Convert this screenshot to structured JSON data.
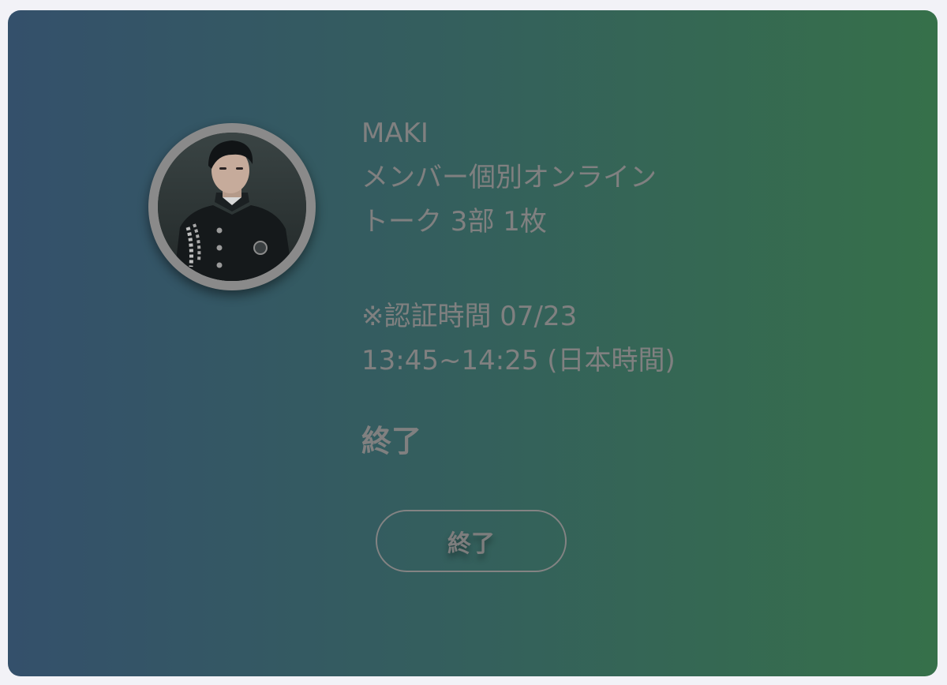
{
  "ticket": {
    "member_name": "MAKI",
    "event_line1": "メンバー個別オンライン",
    "event_line2": "トーク 3部 1枚",
    "auth_line1": "※認証時間 07/23",
    "auth_line2": "13:45~14:25 (日本時間)",
    "status": "終了",
    "button_label": "終了"
  },
  "colors": {
    "background_left": "#34506b",
    "background_right": "#36704a",
    "text": "#808080",
    "ring": "#8a8a8a"
  }
}
